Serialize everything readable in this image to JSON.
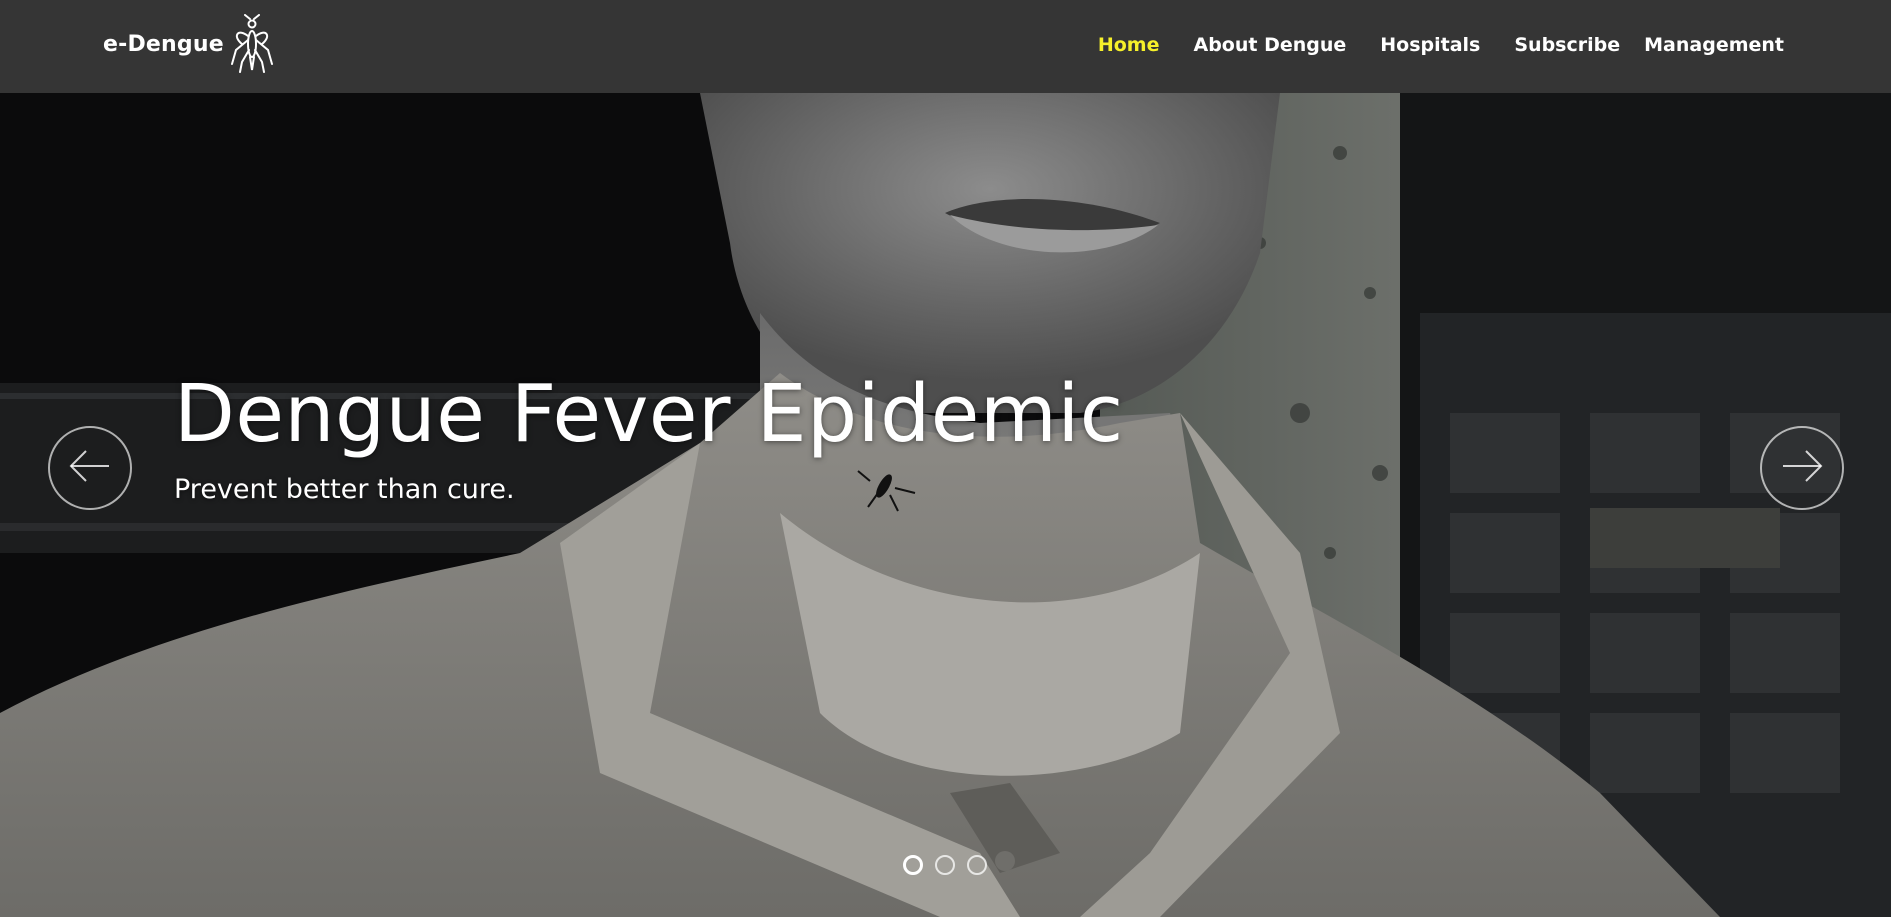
{
  "navbar": {
    "brand": "e-Dengue",
    "brand_icon": "mosquito-icon",
    "links": [
      {
        "label": "Home",
        "active": true
      },
      {
        "label": "About Dengue",
        "active": false
      },
      {
        "label": "Hospitals",
        "active": false
      },
      {
        "label": "Subscribe",
        "active": false
      },
      {
        "label": "Management",
        "active": false
      }
    ],
    "active_color": "#f6f02a"
  },
  "carousel": {
    "slide_title": "Dengue Fever Epidemic",
    "slide_subtitle": "Prevent better than cure.",
    "prev_icon": "arrow-left-icon",
    "next_icon": "arrow-right-icon",
    "slide_count": 3,
    "active_index": 0
  }
}
